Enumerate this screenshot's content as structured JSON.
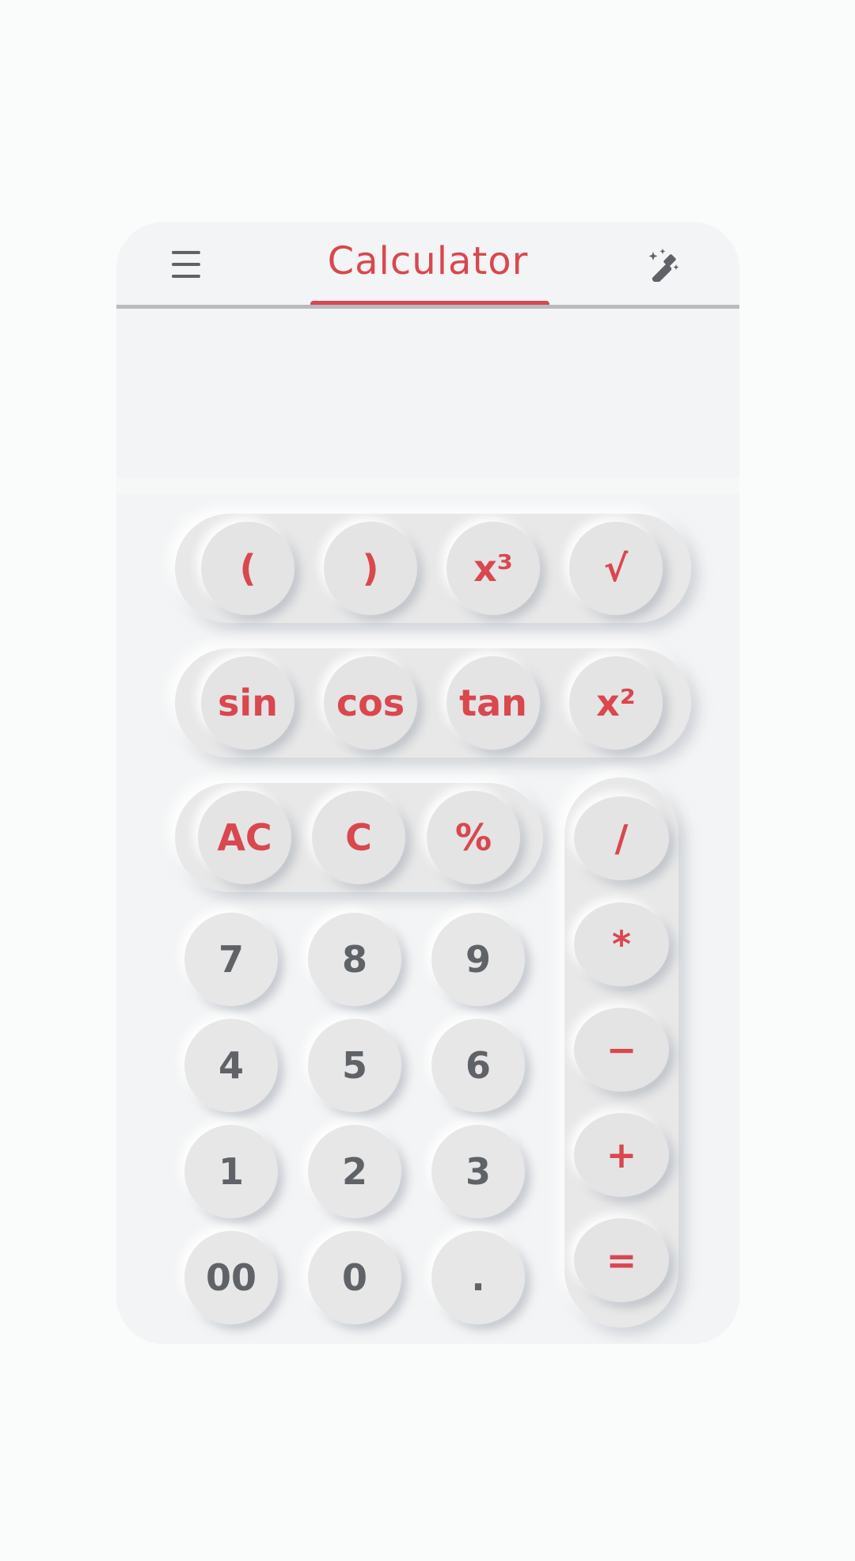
{
  "header": {
    "title": "Calculator",
    "menu_icon": "hamburger-menu-icon",
    "theme_icon": "magic-wand-icon"
  },
  "display": {
    "value": ""
  },
  "colors": {
    "accent": "#d9474f",
    "digit": "#5f6368",
    "background": "#f3f4f5",
    "key": "#e4e4e4"
  },
  "keys": {
    "row1": [
      "(",
      ")",
      "x³",
      "√"
    ],
    "row2": [
      "sin",
      "cos",
      "tan",
      "x²"
    ],
    "row3": [
      "AC",
      "C",
      "%"
    ],
    "digits": [
      [
        "7",
        "8",
        "9"
      ],
      [
        "4",
        "5",
        "6"
      ],
      [
        "1",
        "2",
        "3"
      ],
      [
        "00",
        "0",
        "."
      ]
    ],
    "operators": [
      "/",
      "*",
      "−",
      "+",
      "="
    ]
  }
}
